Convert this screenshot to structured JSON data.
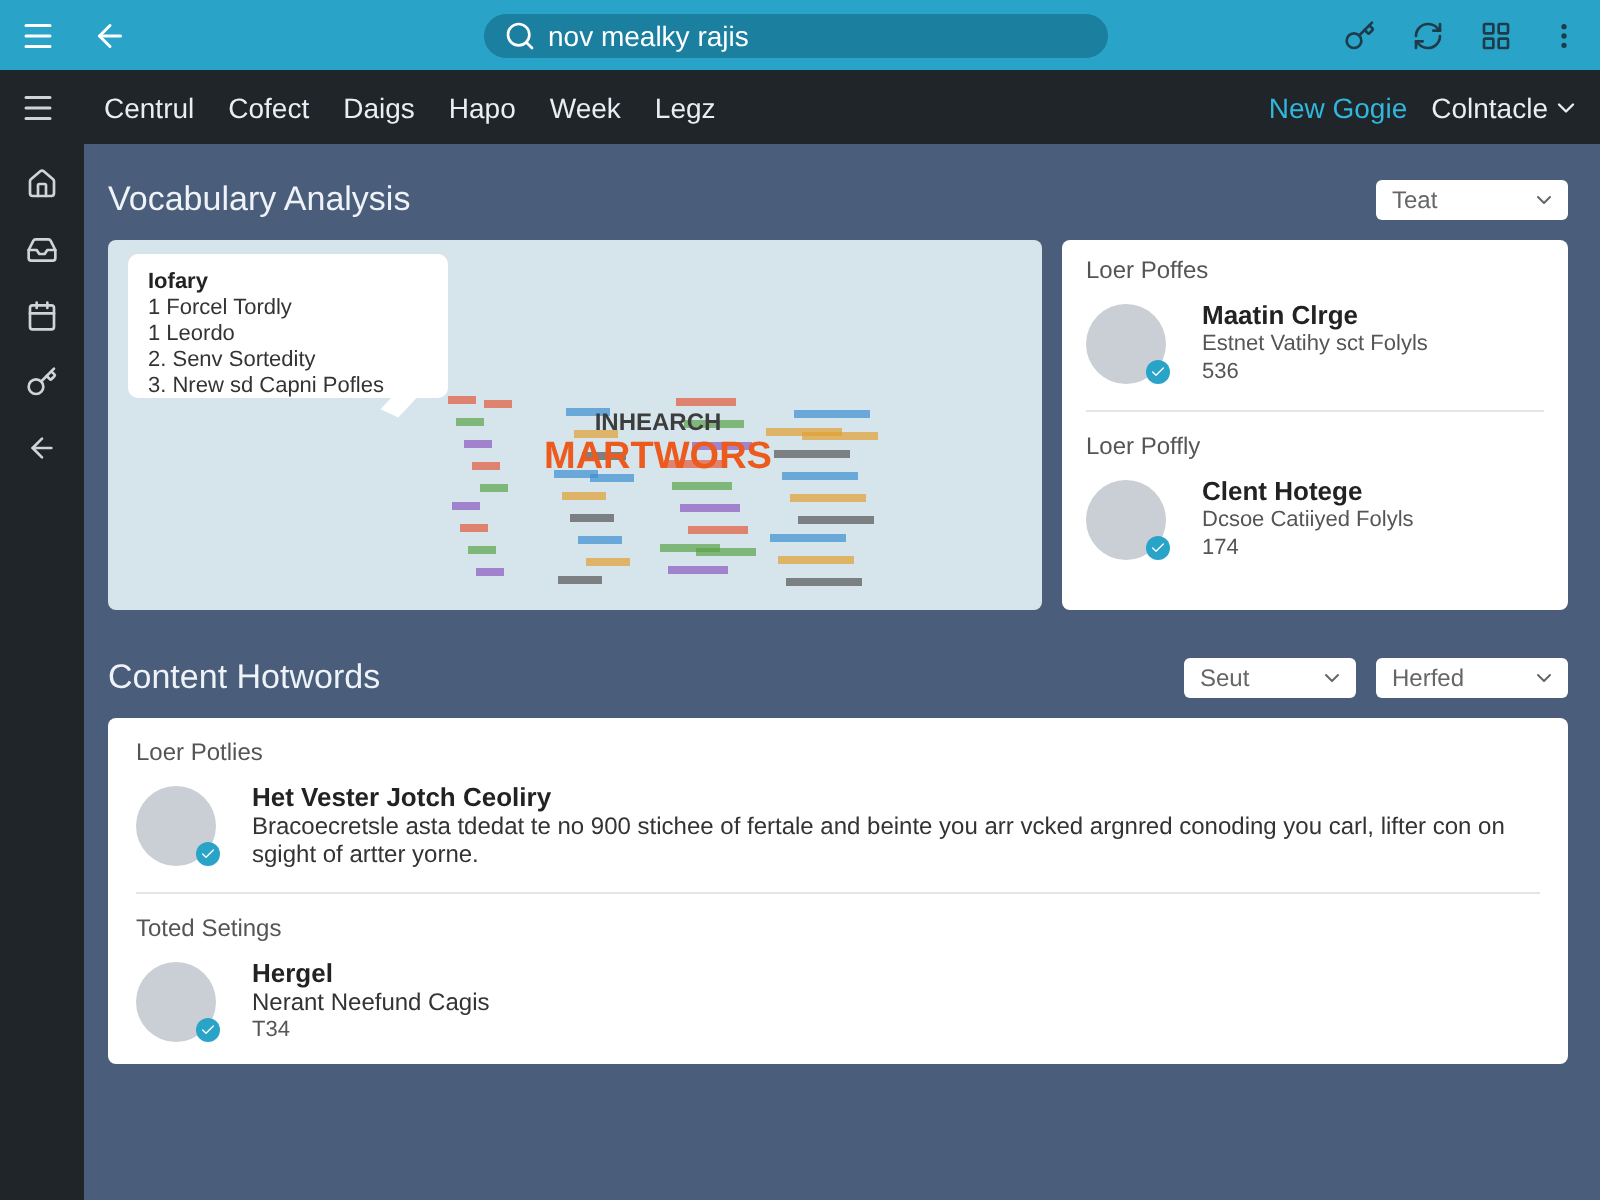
{
  "top_bar": {
    "search": {
      "value": "nov mealky rajis"
    }
  },
  "nav": {
    "items": [
      {
        "label": "Centrul",
        "selected": false
      },
      {
        "label": "Cofect",
        "selected": false
      },
      {
        "label": "Daigs",
        "selected": false
      },
      {
        "label": "Hapo",
        "selected": false
      },
      {
        "label": "Week",
        "selected": false
      },
      {
        "label": "Legz",
        "selected": false
      }
    ],
    "link": "New Gogie",
    "account": "Colntacle"
  },
  "vocabulary": {
    "title": "Vocabulary Analysis",
    "filter": "Teat",
    "bubble": {
      "title": "Iofary",
      "items": [
        "1  Forcel Tordly",
        "1  Leordo",
        "2. Senv Sortedity",
        "3. Nrew sd Capni Pofles"
      ]
    },
    "cloud": {
      "subtitle": "INHEARCH",
      "headline": "MARTWORS"
    },
    "profiles": [
      {
        "section": "Loer Poffes",
        "name": "Maatin Clrge",
        "detail": "Estnet Vatihy sct Folyls",
        "meta": "536",
        "verified": true
      },
      {
        "section": "Loer Poffly",
        "name": "Clent Hotege",
        "detail": "Dcsoe Catiiyed Folyls",
        "meta": "174",
        "verified": true
      }
    ]
  },
  "hotwords": {
    "title": "Content Hotwords",
    "filters": [
      "Seut",
      "Herfed"
    ],
    "entries": [
      {
        "section": "Loer Potlies",
        "name": "Het Vester Jotch Ceoliry",
        "text": "Bracoecretsle asta tdedat te no 900 stichee of fertale and beinte you arr vcked argnred conoding you carl, lifter con on sgight of artter yorne.",
        "verified": true
      },
      {
        "section": "Toted Setings",
        "name": "Hergel",
        "text": "Nerant Neefund Cagis",
        "meta": "T34",
        "verified": true
      }
    ]
  }
}
